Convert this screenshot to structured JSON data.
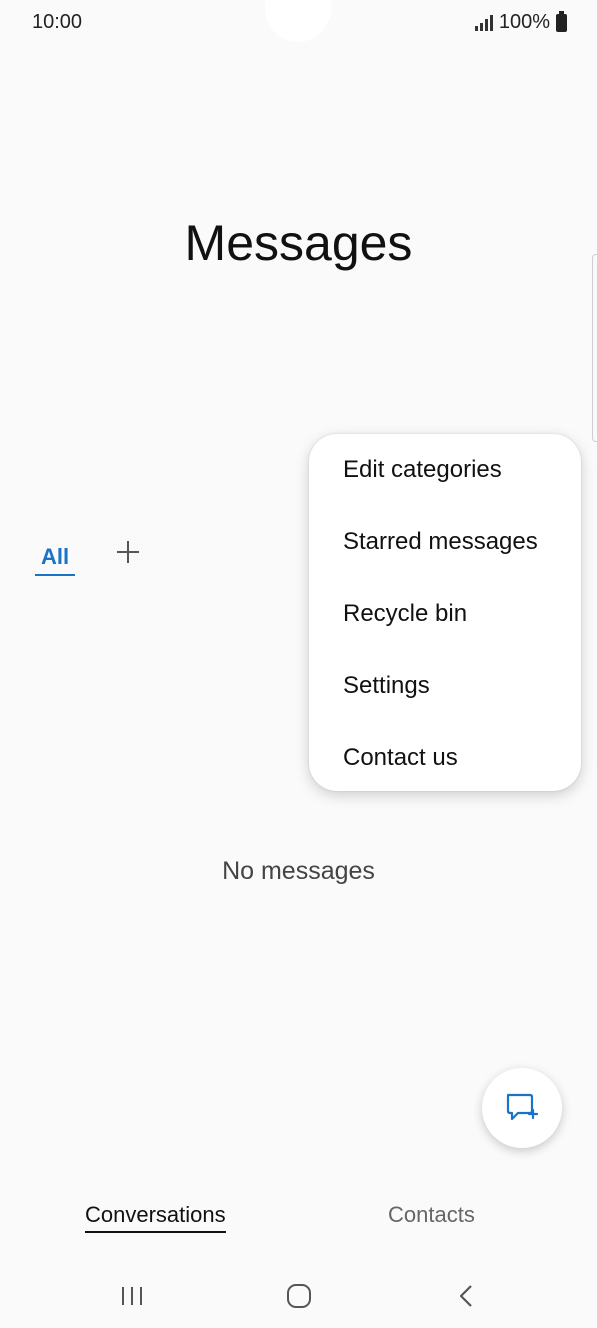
{
  "status_bar": {
    "time": "10:00",
    "battery_text": "100%"
  },
  "page": {
    "title": "Messages"
  },
  "categories": {
    "tabs": [
      {
        "label": "All",
        "selected": true
      }
    ],
    "add_icon": "plus-icon"
  },
  "popup_menu": {
    "items": [
      {
        "label": "Edit categories"
      },
      {
        "label": "Starred messages"
      },
      {
        "label": "Recycle bin"
      },
      {
        "label": "Settings"
      },
      {
        "label": "Contact us"
      }
    ]
  },
  "empty_state": {
    "text": "No messages"
  },
  "fab": {
    "icon": "new-message-icon"
  },
  "bottom_tabs": [
    {
      "label": "Conversations",
      "selected": true
    },
    {
      "label": "Contacts",
      "selected": false
    }
  ],
  "nav_bar": {
    "icons": [
      "recent-apps-icon",
      "home-icon",
      "back-icon"
    ]
  },
  "colors": {
    "accent": "#1a73c9",
    "background": "#fafafa",
    "text": "#111111"
  }
}
